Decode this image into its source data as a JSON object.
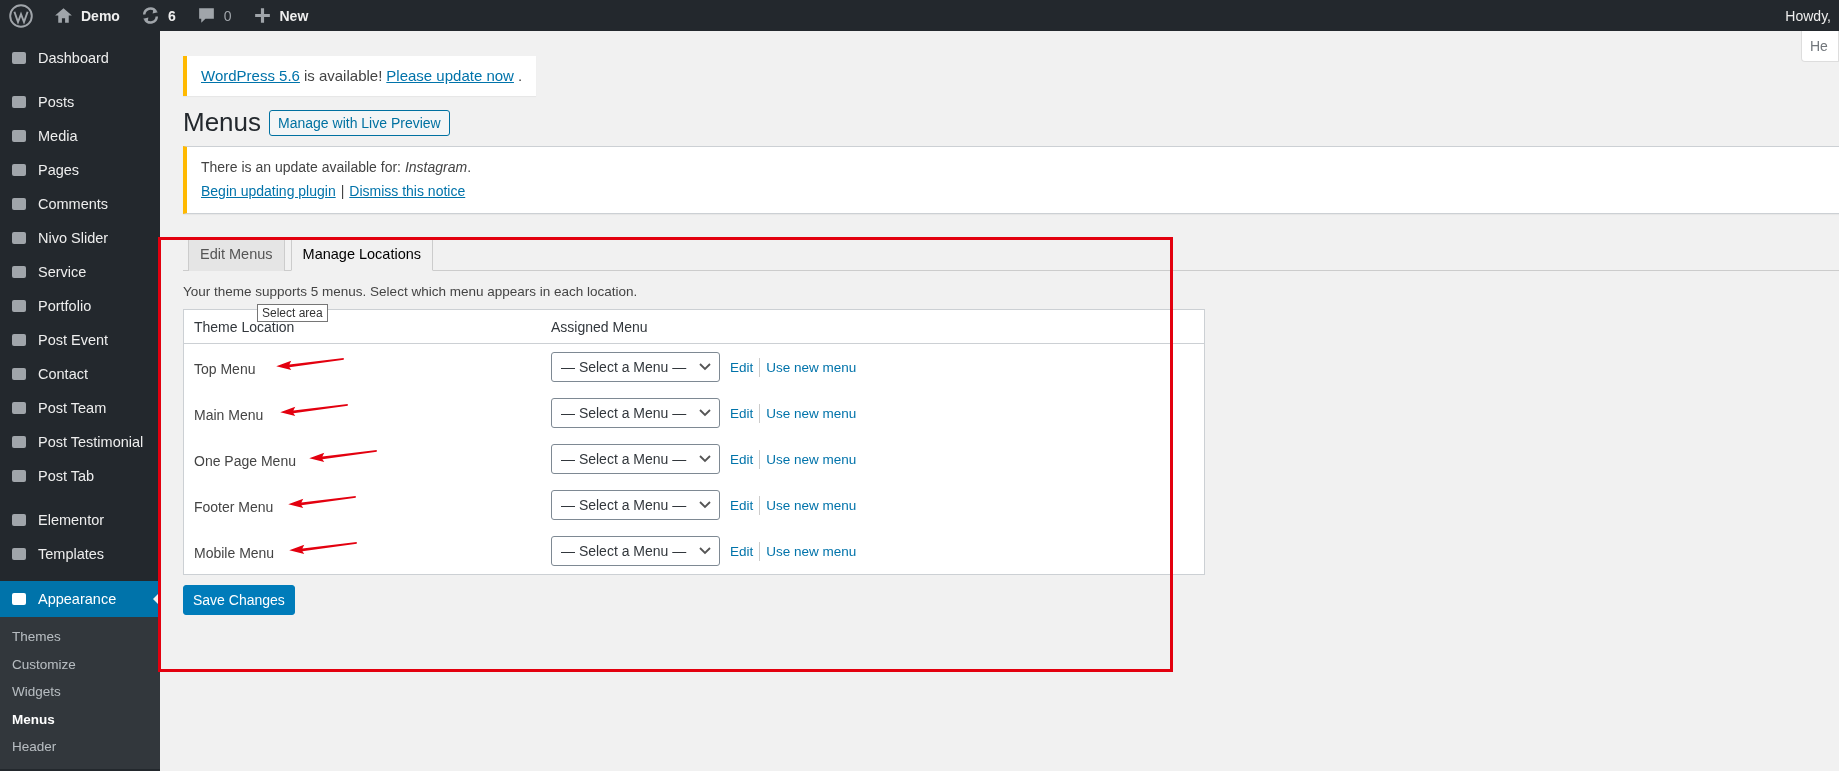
{
  "admin_bar": {
    "site": "Demo",
    "updates": "6",
    "comments": "0",
    "new": "New",
    "greeting": "Howdy,"
  },
  "help_tab": "He",
  "sidebar": {
    "groups": [
      {
        "items": [
          {
            "label": "Dashboard",
            "selected": false
          }
        ]
      },
      {
        "items": [
          {
            "label": "Posts",
            "selected": false
          },
          {
            "label": "Media",
            "selected": false
          },
          {
            "label": "Pages",
            "selected": false
          },
          {
            "label": "Comments",
            "selected": false
          },
          {
            "label": "Nivo Slider",
            "selected": false
          },
          {
            "label": "Service",
            "selected": false
          },
          {
            "label": "Portfolio",
            "selected": false
          },
          {
            "label": "Post Event",
            "selected": false
          },
          {
            "label": "Contact",
            "selected": false
          },
          {
            "label": "Post Team",
            "selected": false
          },
          {
            "label": "Post Testimonial",
            "selected": false
          },
          {
            "label": "Post Tab",
            "selected": false
          }
        ]
      },
      {
        "items": [
          {
            "label": "Elementor",
            "selected": false
          },
          {
            "label": "Templates",
            "selected": false
          }
        ]
      },
      {
        "items": [
          {
            "label": "Appearance",
            "selected": true,
            "children": [
              {
                "label": "Themes",
                "selected": false
              },
              {
                "label": "Customize",
                "selected": false
              },
              {
                "label": "Widgets",
                "selected": false
              },
              {
                "label": "Menus",
                "selected": true
              },
              {
                "label": "Header",
                "selected": false
              }
            ]
          }
        ]
      }
    ]
  },
  "update_notice": {
    "version_link": "WordPress 5.6",
    "text": "is available!",
    "update_link": "Please update now",
    "end": "."
  },
  "page_title": "Menus",
  "live_preview_button": "Manage with Live Preview",
  "plugin_notice": {
    "text": "There is an update available for: *Instagram*.",
    "begin_link": "Begin updating plugin",
    "separator": "|",
    "dismiss_link": "Dismiss this notice"
  },
  "tabs": [
    {
      "label": "Edit Menus",
      "selected": false
    },
    {
      "label": "Manage Locations",
      "selected": true
    }
  ],
  "description": "Your theme supports 5 menus. Select which menu appears in each location.",
  "tooltip": "Select area",
  "table": {
    "columns": [
      "Theme Location",
      "Assigned Menu"
    ],
    "rows": [
      {
        "location": "Top Menu",
        "menu": "— Select a Menu —",
        "edit": "Edit",
        "use_new": "Use new menu"
      },
      {
        "location": "Main Menu",
        "menu": "— Select a Menu —",
        "edit": "Edit",
        "use_new": "Use new menu"
      },
      {
        "location": "One Page Menu",
        "menu": "— Select a Menu —",
        "edit": "Edit",
        "use_new": "Use new menu"
      },
      {
        "location": "Footer Menu",
        "menu": "— Select a Menu —",
        "edit": "Edit",
        "use_new": "Use new menu"
      },
      {
        "location": "Mobile Menu",
        "menu": "— Select a Menu —",
        "edit": "Edit",
        "use_new": "Use new menu"
      }
    ]
  },
  "save_button": "Save Changes"
}
